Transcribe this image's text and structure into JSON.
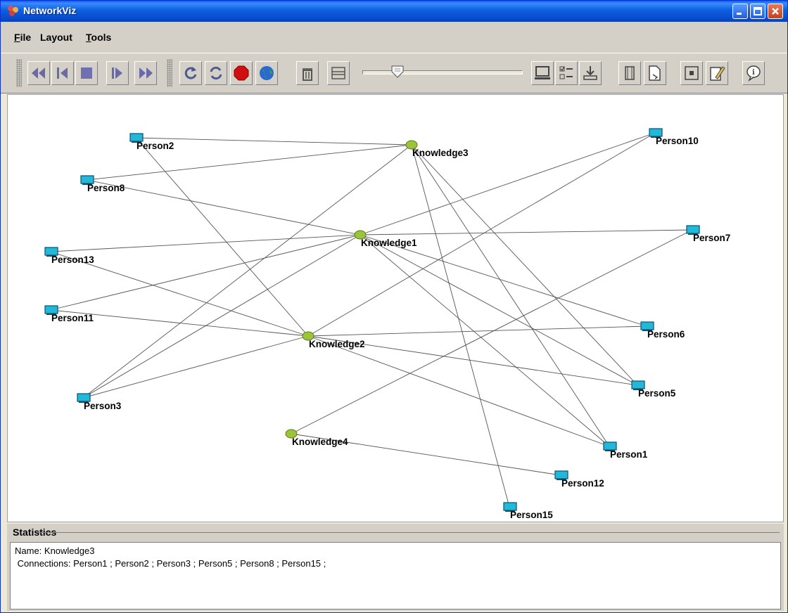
{
  "window": {
    "title": "NetworkViz"
  },
  "menu": [
    {
      "label": "File",
      "mnemonic": "F",
      "rest": "ile"
    },
    {
      "label": "Layout",
      "mnemonic": "",
      "rest": "Layout"
    },
    {
      "label": "Tools",
      "mnemonic": "T",
      "rest": "ools"
    }
  ],
  "toolbar_icons": [
    "rewind-icon",
    "step-back-icon",
    "stop-square-icon",
    "step-forward-icon",
    "fast-forward-icon",
    "refresh-icon",
    "cycle-icon",
    "stop-sign-icon",
    "globe-icon",
    "trash-icon",
    "columns-icon",
    "computer-icon",
    "checklist-icon",
    "download-icon",
    "frame-icon",
    "document-arrow-icon",
    "center-icon",
    "edit-icon",
    "help-bubble-icon"
  ],
  "colors": {
    "person_node": "#22b8d8",
    "knowledge_node": "#9cc43a",
    "edge": "#555555",
    "titlebar": "#0a5fe5"
  },
  "graph": {
    "nodes": [
      {
        "id": "Person2",
        "type": "person"
      },
      {
        "id": "Knowledge3",
        "type": "knowledge"
      },
      {
        "id": "Person10",
        "type": "person"
      },
      {
        "id": "Person8",
        "type": "person"
      },
      {
        "id": "Knowledge1",
        "type": "knowledge"
      },
      {
        "id": "Person7",
        "type": "person"
      },
      {
        "id": "Person13",
        "type": "person"
      },
      {
        "id": "Person11",
        "type": "person"
      },
      {
        "id": "Knowledge2",
        "type": "knowledge"
      },
      {
        "id": "Person6",
        "type": "person"
      },
      {
        "id": "Person5",
        "type": "person"
      },
      {
        "id": "Person3",
        "type": "person"
      },
      {
        "id": "Knowledge4",
        "type": "knowledge"
      },
      {
        "id": "Person1",
        "type": "person"
      },
      {
        "id": "Person12",
        "type": "person"
      },
      {
        "id": "Person15",
        "type": "person"
      }
    ],
    "edges": [
      [
        "Person2",
        "Knowledge3"
      ],
      [
        "Person8",
        "Knowledge3"
      ],
      [
        "Person3",
        "Knowledge3"
      ],
      [
        "Person5",
        "Knowledge3"
      ],
      [
        "Person1",
        "Knowledge3"
      ],
      [
        "Person15",
        "Knowledge3"
      ],
      [
        "Person8",
        "Knowledge1"
      ],
      [
        "Person13",
        "Knowledge1"
      ],
      [
        "Person11",
        "Knowledge1"
      ],
      [
        "Person3",
        "Knowledge1"
      ],
      [
        "Person10",
        "Knowledge1"
      ],
      [
        "Person7",
        "Knowledge1"
      ],
      [
        "Person6",
        "Knowledge1"
      ],
      [
        "Person5",
        "Knowledge1"
      ],
      [
        "Person1",
        "Knowledge1"
      ],
      [
        "Person2",
        "Knowledge2"
      ],
      [
        "Person13",
        "Knowledge2"
      ],
      [
        "Person11",
        "Knowledge2"
      ],
      [
        "Person3",
        "Knowledge2"
      ],
      [
        "Person10",
        "Knowledge2"
      ],
      [
        "Person6",
        "Knowledge2"
      ],
      [
        "Person5",
        "Knowledge2"
      ],
      [
        "Person1",
        "Knowledge2"
      ],
      [
        "Person7",
        "Knowledge4"
      ],
      [
        "Person12",
        "Knowledge4"
      ]
    ]
  },
  "statistics": {
    "title": "Statistics",
    "name_line": "Name: Knowledge3",
    "connections_line": " Connections: Person1 ; Person2 ; Person3 ; Person5 ; Person8 ; Person15 ;"
  }
}
